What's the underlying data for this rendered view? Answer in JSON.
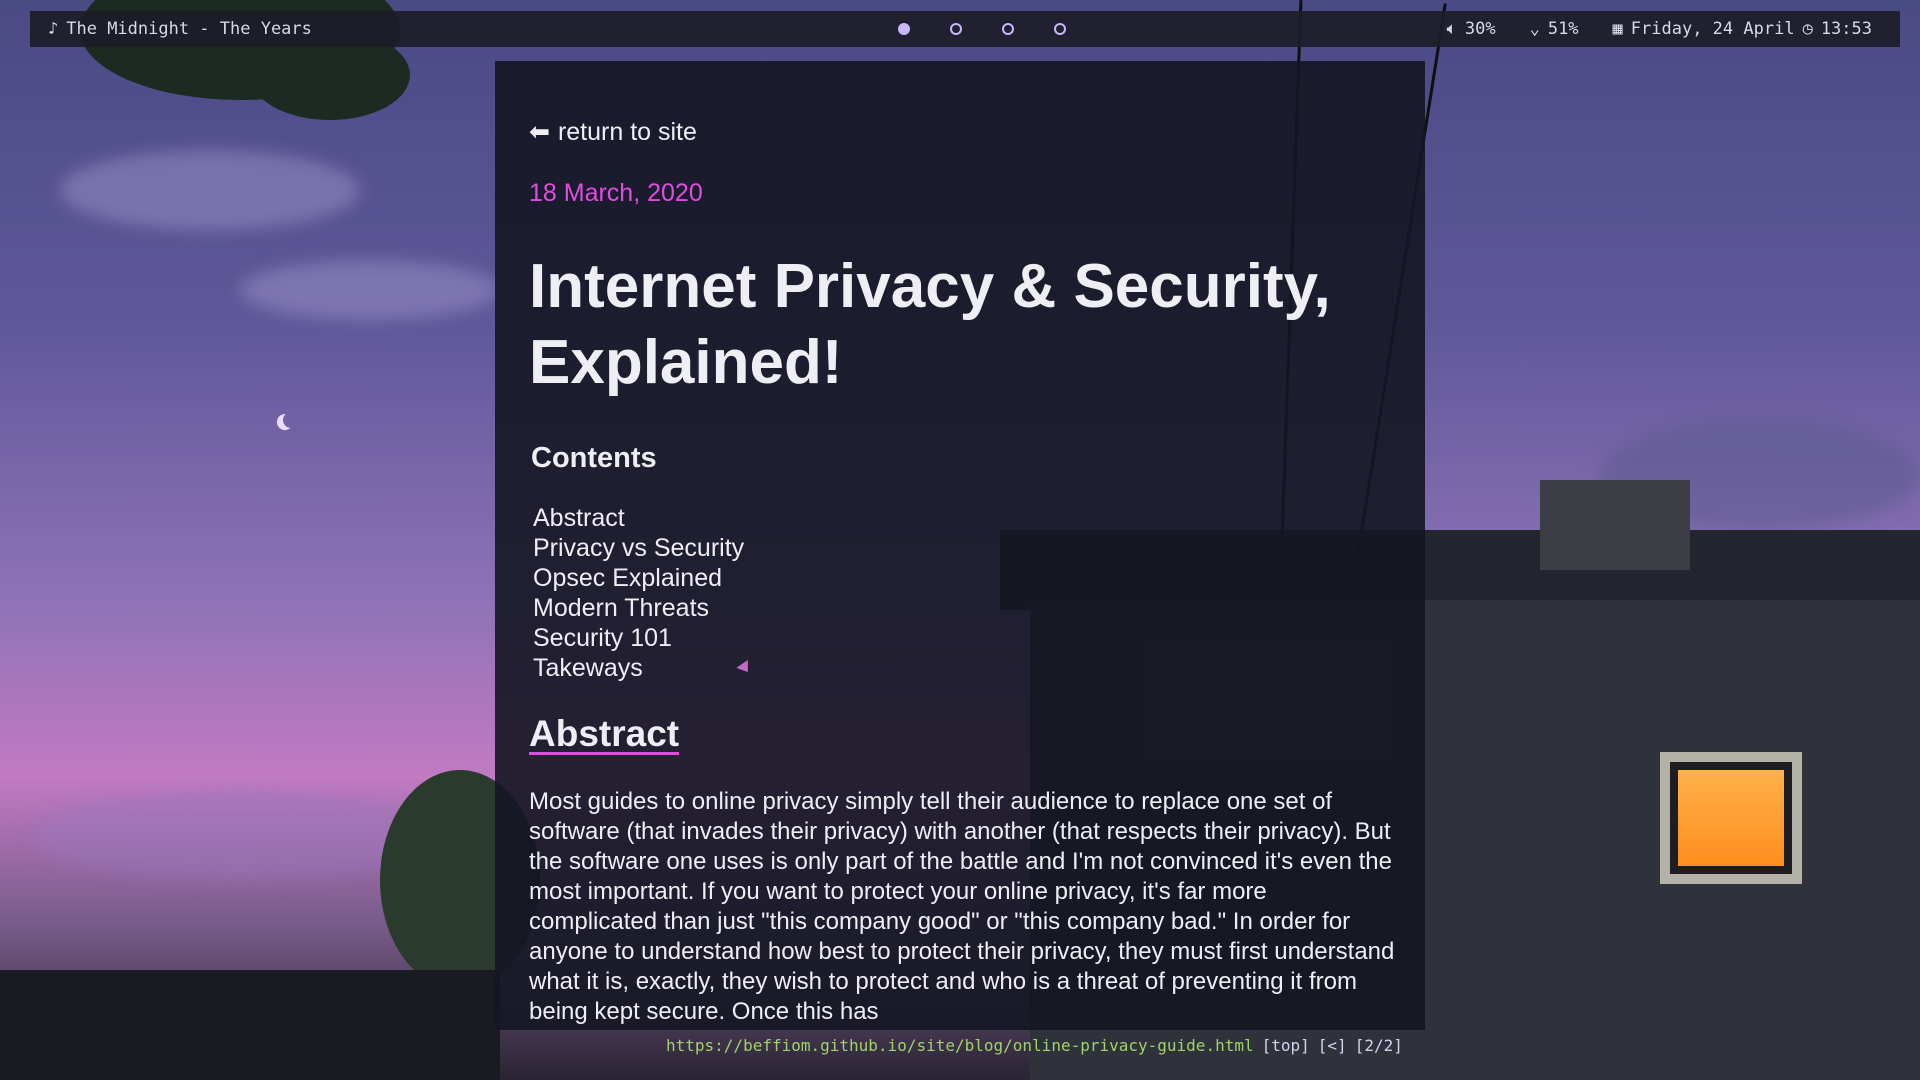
{
  "topbar": {
    "now_playing_icon": "music-note-icon",
    "now_playing": "The Midnight - The Years",
    "workspaces": [
      {
        "active": true
      },
      {
        "active": false
      },
      {
        "active": false
      },
      {
        "active": false
      }
    ],
    "volume_icon": "speaker-icon",
    "volume": "30%",
    "wifi_icon": "wifi-icon",
    "wifi": "51%",
    "calendar_icon": "calendar-icon",
    "date": "Friday, 24 April",
    "clock_icon": "clock-icon",
    "time": "13:53"
  },
  "page": {
    "back_icon": "arrow-left-icon",
    "back_label": "return to site",
    "date": "18 March, 2020",
    "title": "Internet Privacy & Security, Explained!",
    "contents_heading": "Contents",
    "toc": [
      "Abstract",
      "Privacy vs Security",
      "Opsec Explained",
      "Modern Threats",
      "Security 101",
      "Takeways"
    ],
    "section_heading": "Abstract",
    "paragraph": "Most guides to online privacy simply tell their audience to replace one set of software (that invades their privacy) with another (that respects their privacy). But the software one uses is only part of the battle and I'm not convinced it's even the most important. If you want to protect your online privacy, it's far more complicated than just \"this company good\" or \"this company bad.\" In order for anyone to understand how best to protect their privacy, they must first understand what it is, exactly, they wish to protect and who is a threat of preventing it from being kept secure. Once this has"
  },
  "statusline": {
    "url": "https://beffiom.github.io/site/blog/online-privacy-guide.html",
    "position": "[top]",
    "history": "[<]",
    "tabs": "[2/2]"
  },
  "colors": {
    "accent": "#e14ce0",
    "url": "#9fd36a",
    "workspace": "#c8b7ff",
    "window_light": "#ffa033"
  }
}
